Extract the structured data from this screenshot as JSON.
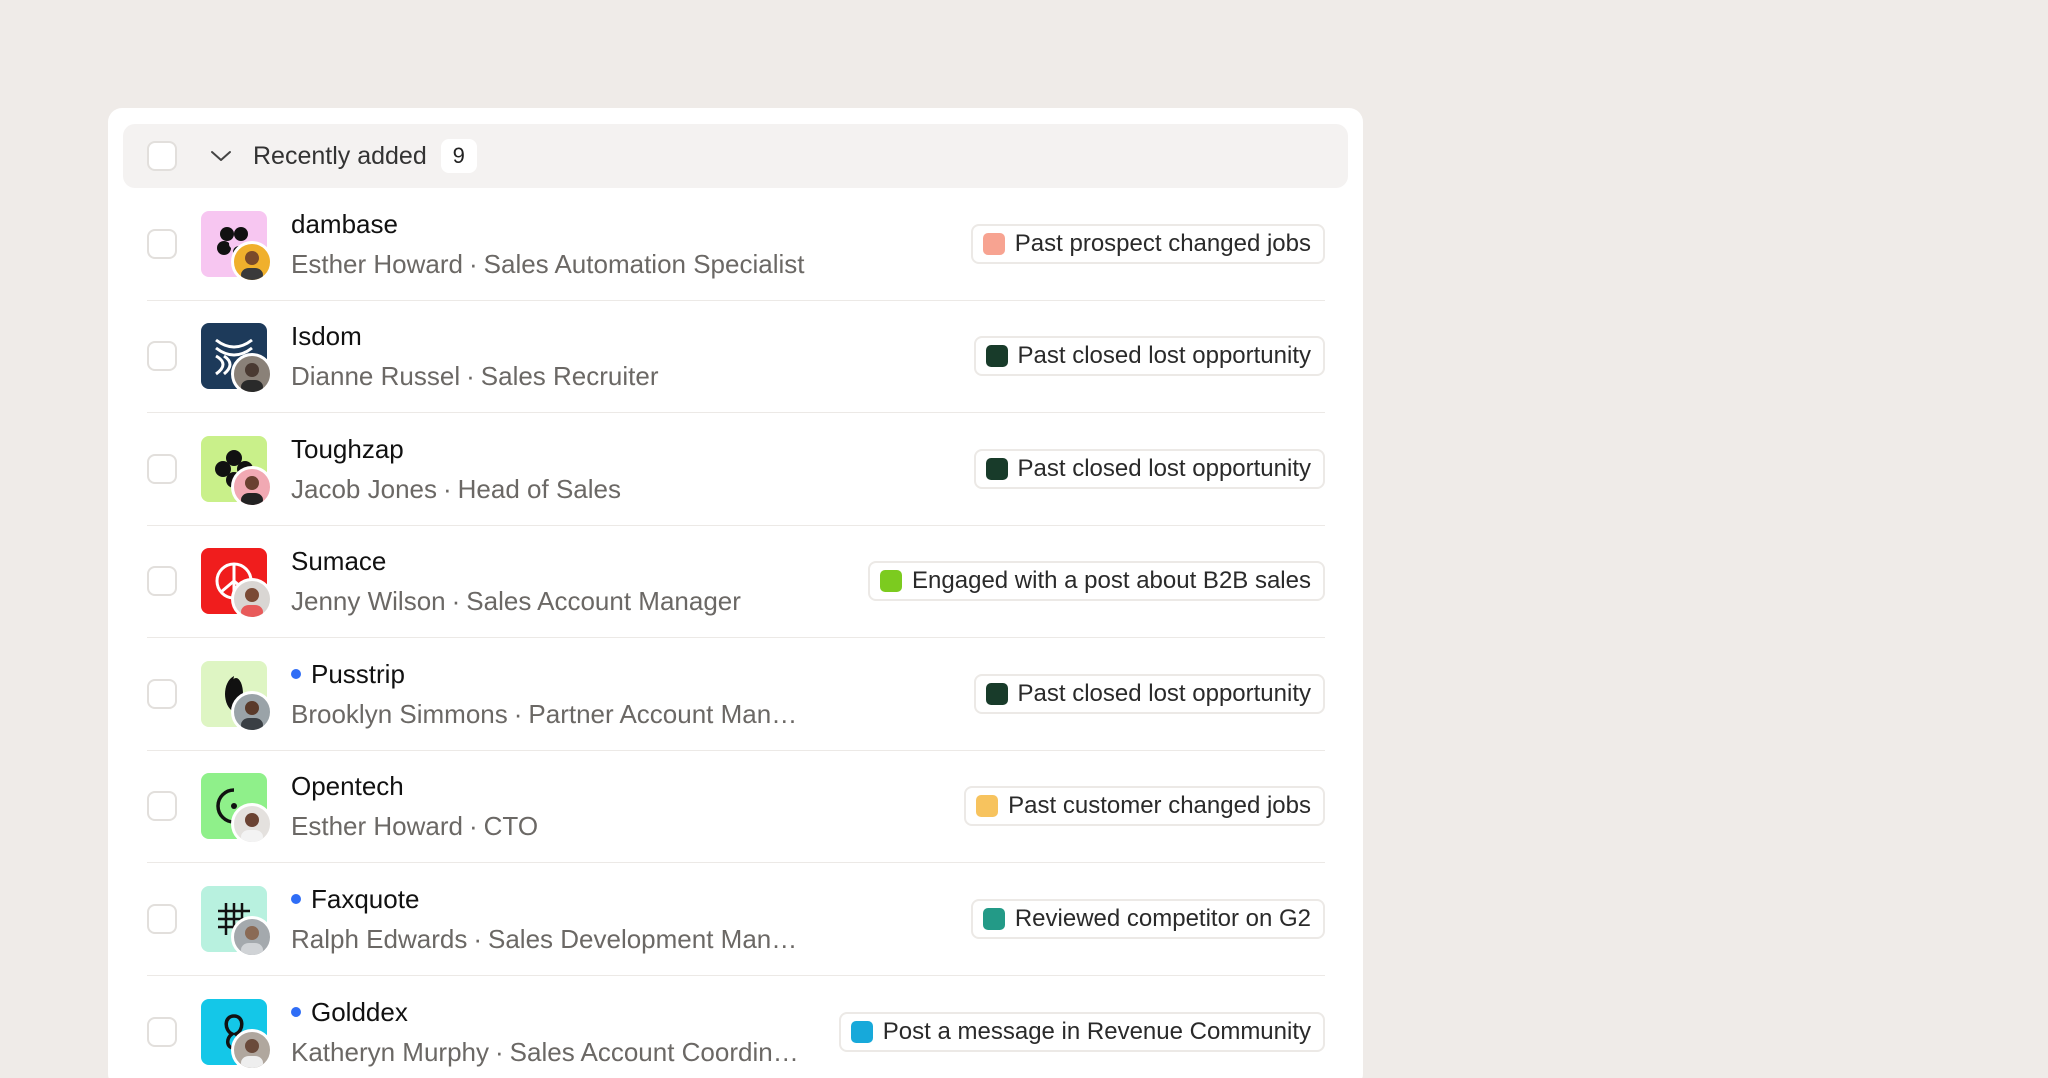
{
  "group": {
    "title": "Recently added",
    "count": "9"
  },
  "rows": [
    {
      "company": "dambase",
      "person": "Esther Howard",
      "role": "Sales Automation Specialist",
      "is_new": false,
      "logo_bg": "#f7c6f1",
      "avatar_bg": "#f0b02c",
      "signal": "Past prospect changed jobs",
      "signal_color": "#f7a391"
    },
    {
      "company": "Isdom",
      "person": "Dianne Russel",
      "role": "Sales Recruiter",
      "is_new": false,
      "logo_bg": "#1d3a5a",
      "avatar_bg": "#8a8178",
      "signal": "Past closed lost opportunity",
      "signal_color": "#183b2a"
    },
    {
      "company": "Toughzap",
      "person": "Jacob Jones",
      "role": "Head of Sales",
      "is_new": false,
      "logo_bg": "#c9f08a",
      "avatar_bg": "#f1a9b3",
      "signal": "Past closed lost opportunity",
      "signal_color": "#183b2a"
    },
    {
      "company": "Sumace",
      "person": "Jenny Wilson",
      "role": "Sales Account Manager",
      "is_new": false,
      "logo_bg": "#f01d1d",
      "avatar_bg": "#d9d6d3",
      "signal": "Engaged with a post about B2B sales",
      "signal_color": "#7ccb1f"
    },
    {
      "company": "Pusstrip",
      "person": "Brooklyn Simmons",
      "role": "Partner Account Manager",
      "is_new": true,
      "logo_bg": "#def5c3",
      "avatar_bg": "#9aa3a8",
      "signal": "Past closed lost opportunity",
      "signal_color": "#183b2a"
    },
    {
      "company": "Opentech",
      "person": "Esther Howard",
      "role": "CTO",
      "is_new": false,
      "logo_bg": "#8ff08a",
      "avatar_bg": "#e4e1de",
      "signal": "Past customer changed jobs",
      "signal_color": "#f7c35e"
    },
    {
      "company": "Faxquote",
      "person": "Ralph Edwards",
      "role": "Sales Development Manager",
      "is_new": true,
      "logo_bg": "#b8f1df",
      "avatar_bg": "#a4a9ad",
      "signal": "Reviewed competitor on G2",
      "signal_color": "#239a87"
    },
    {
      "company": "Golddex",
      "person": "Katheryn Murphy",
      "role": "Sales Account Coordin…",
      "is_new": true,
      "logo_bg": "#14c7e8",
      "avatar_bg": "#b0a79e",
      "signal": "Post a message in Revenue Community",
      "signal_color": "#17a9da"
    }
  ]
}
